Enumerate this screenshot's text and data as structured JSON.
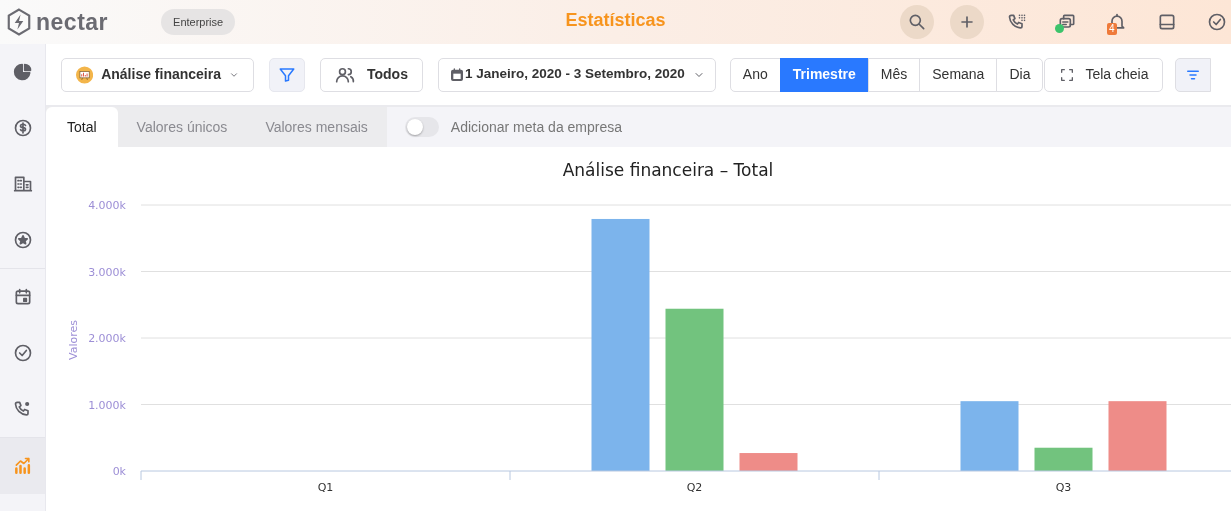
{
  "header": {
    "logo": "nectar",
    "plan": "Enterprise",
    "title": "Estatísticas",
    "notification_count": "4",
    "online": true
  },
  "sidebar": {
    "items": [
      {
        "selected": false
      },
      {
        "selected": false
      },
      {
        "selected": false
      },
      {
        "selected": false
      },
      {
        "selected": false
      },
      {
        "selected": false
      },
      {
        "selected": false
      },
      {
        "selected": true
      }
    ]
  },
  "toolbar": {
    "report": "Análise financeira",
    "users": "Todos",
    "date_range": "1 Janeiro, 2020 - 3 Setembro, 2020",
    "periods": [
      {
        "label": "Ano",
        "selected": false
      },
      {
        "label": "Trimestre",
        "selected": true
      },
      {
        "label": "Mês",
        "selected": false
      },
      {
        "label": "Semana",
        "selected": false
      },
      {
        "label": "Dia",
        "selected": false
      }
    ],
    "fullscreen": "Tela cheia"
  },
  "tabs": [
    {
      "label": "Total",
      "selected": true
    },
    {
      "label": "Valores únicos",
      "selected": false
    },
    {
      "label": "Valores mensais",
      "selected": false
    }
  ],
  "goal_toggle": {
    "label": "Adicionar meta da empresa",
    "on": false
  },
  "chart": {
    "chart_data": {
      "type": "bar",
      "title": "Análise financeira – Total",
      "ylabel": "Valores",
      "categories": [
        "Q1",
        "Q2",
        "Q3"
      ],
      "series": [
        {
          "color": "#7cb4ec",
          "values": [
            0,
            3790,
            1050
          ]
        },
        {
          "color": "#72c37e",
          "values": [
            0,
            2440,
            350
          ]
        },
        {
          "color": "#ee8c88",
          "values": [
            0,
            270,
            1050
          ]
        }
      ],
      "ylim": [
        0,
        4000
      ],
      "grid": true,
      "yticks": [
        {
          "value": 0,
          "label": "0k"
        },
        {
          "value": 1000,
          "label": "1.000k"
        },
        {
          "value": 2000,
          "label": "2.000k"
        },
        {
          "value": 3000,
          "label": "3.000k"
        },
        {
          "value": 4000,
          "label": "4.000k"
        }
      ]
    }
  }
}
